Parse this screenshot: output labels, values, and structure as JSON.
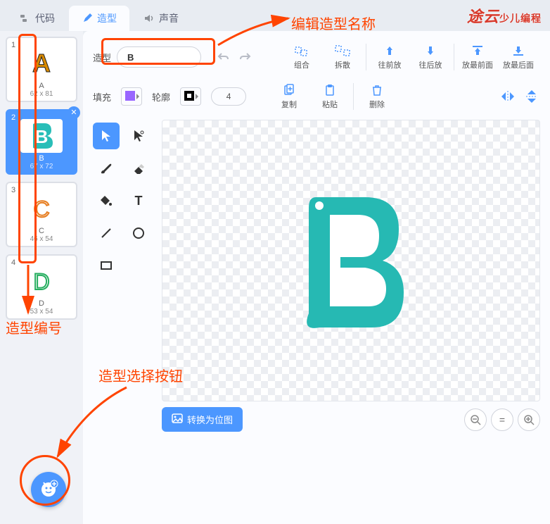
{
  "tabs": {
    "code": "代码",
    "costume": "造型",
    "sound": "声音"
  },
  "costume_name_label": "造型",
  "costume_name_value": "B",
  "thumbs": [
    {
      "num": "1",
      "label": "A",
      "size": "62 x 81"
    },
    {
      "num": "2",
      "label": "B",
      "size": "67 x 72"
    },
    {
      "num": "3",
      "label": "C",
      "size": "46 x 54"
    },
    {
      "num": "4",
      "label": "D",
      "size": "53 x 54"
    }
  ],
  "toolbar": {
    "group": "组合",
    "ungroup": "拆散",
    "forward": "往前放",
    "backward": "往后放",
    "front": "放最前面",
    "back": "放最后面",
    "copy": "复制",
    "paste": "粘贴",
    "delete": "删除"
  },
  "fill_label": "填充",
  "stroke_label": "轮廓",
  "stroke_width": "4",
  "convert_label": "转换为位图",
  "annotations": {
    "edit_name": "编辑造型名称",
    "costume_number": "造型编号",
    "select_button": "造型选择按钮"
  },
  "watermark": {
    "brand": "途云",
    "tag": "少儿编程"
  }
}
